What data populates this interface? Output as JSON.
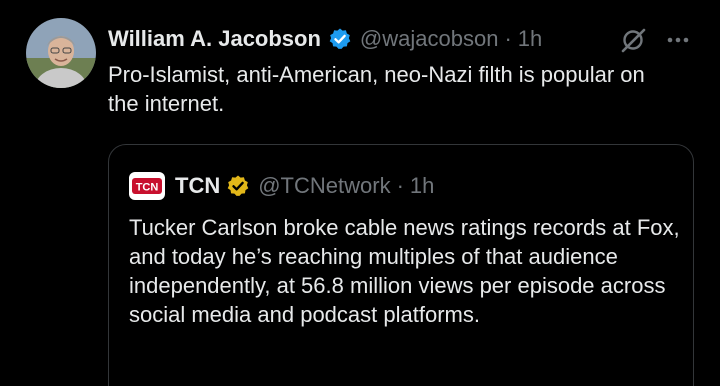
{
  "tweet": {
    "author_name": "William A. Jacobson",
    "handle": "@wajacobson",
    "separator": "·",
    "time": "1h",
    "text": "Pro-Islamist, anti-American, neo-Nazi filth is popular on the internet.",
    "verified_color": "#1d9bf0"
  },
  "quote": {
    "logo_text": "TCN",
    "author_name": "TCN",
    "handle": "@TCNetwork",
    "separator": "·",
    "time": "1h",
    "text": "Tucker Carlson broke cable news ratings records at Fox, and today he’s reaching multiples of that audience independently, at 56.8 million views per episode across social media and podcast platforms.",
    "verified_color": "#e2b719"
  },
  "icons": {
    "grok": "grok-icon",
    "more": "more-icon",
    "verified": "verified-badge-icon"
  }
}
